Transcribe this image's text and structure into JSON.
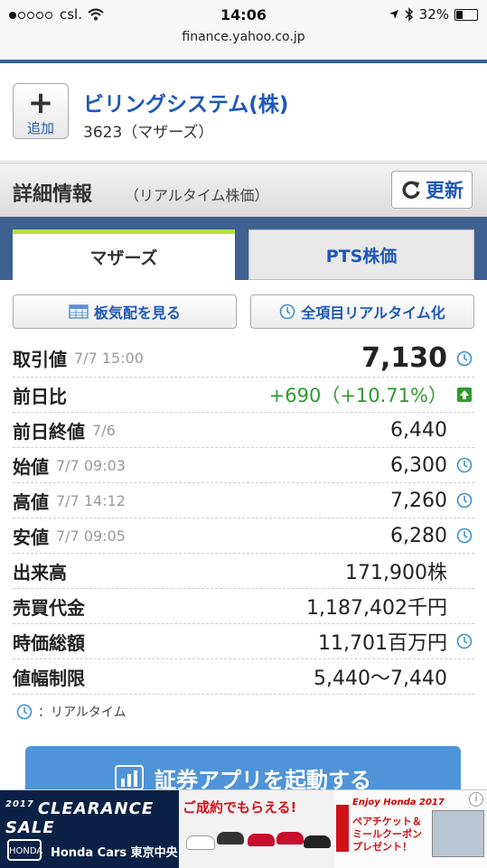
{
  "status": {
    "carrier": "csl.",
    "time": "14:06",
    "battery": "32%",
    "battery_level": 0.32
  },
  "browser": {
    "url": "finance.yahoo.co.jp"
  },
  "stock": {
    "add_label": "追加",
    "name": "ビリングシステム(株)",
    "code": "3623（マザーズ）"
  },
  "section": {
    "title": "詳細情報",
    "subtitle": "（リアルタイム株価）",
    "refresh_label": "更新"
  },
  "tabs": [
    {
      "label": "マザーズ"
    },
    {
      "label": "PTS株価"
    }
  ],
  "actions": {
    "board_label": "板気配を見る",
    "realtime_label": "全項目リアルタイム化"
  },
  "rows": [
    {
      "label": "取引値",
      "date": "7/7 15:00",
      "value": "7,130"
    },
    {
      "label": "前日比",
      "date": "",
      "value": "+690（+10.71%）"
    },
    {
      "label": "前日終値",
      "date": "7/6",
      "value": "6,440"
    },
    {
      "label": "始値",
      "date": "7/7 09:03",
      "value": "6,300"
    },
    {
      "label": "高値",
      "date": "7/7 14:12",
      "value": "7,260"
    },
    {
      "label": "安値",
      "date": "7/7 09:05",
      "value": "6,280"
    },
    {
      "label": "出来高",
      "date": "",
      "value": "171,900株"
    },
    {
      "label": "売買代金",
      "date": "",
      "value": "1,187,402千円"
    },
    {
      "label": "時価総額",
      "date": "",
      "value": "11,701百万円"
    },
    {
      "label": "値幅制限",
      "date": "",
      "value": "5,440〜7,440"
    }
  ],
  "legend": {
    "text": "：リアルタイム"
  },
  "app_button": {
    "label": "証券アプリを起動する"
  },
  "ad": {
    "banner1_year": "2017",
    "banner1_title": "CLEARANCE SALE",
    "banner1_logo": "HONDA",
    "banner1_brand": "Honda Cars 東京中央",
    "banner2_text": "ご成約でもらえる!",
    "banner3_title": "Enjoy Honda 2017",
    "banner3_text": "ペアチケット＆ミールクーポンプレゼント！"
  },
  "colors": {
    "link_blue": "#1e58b8",
    "up_green": "#2e9a2e",
    "tab_bar": "#3e618f",
    "tab_accent": "#b5e03a",
    "app_button": "#4f94d8"
  }
}
